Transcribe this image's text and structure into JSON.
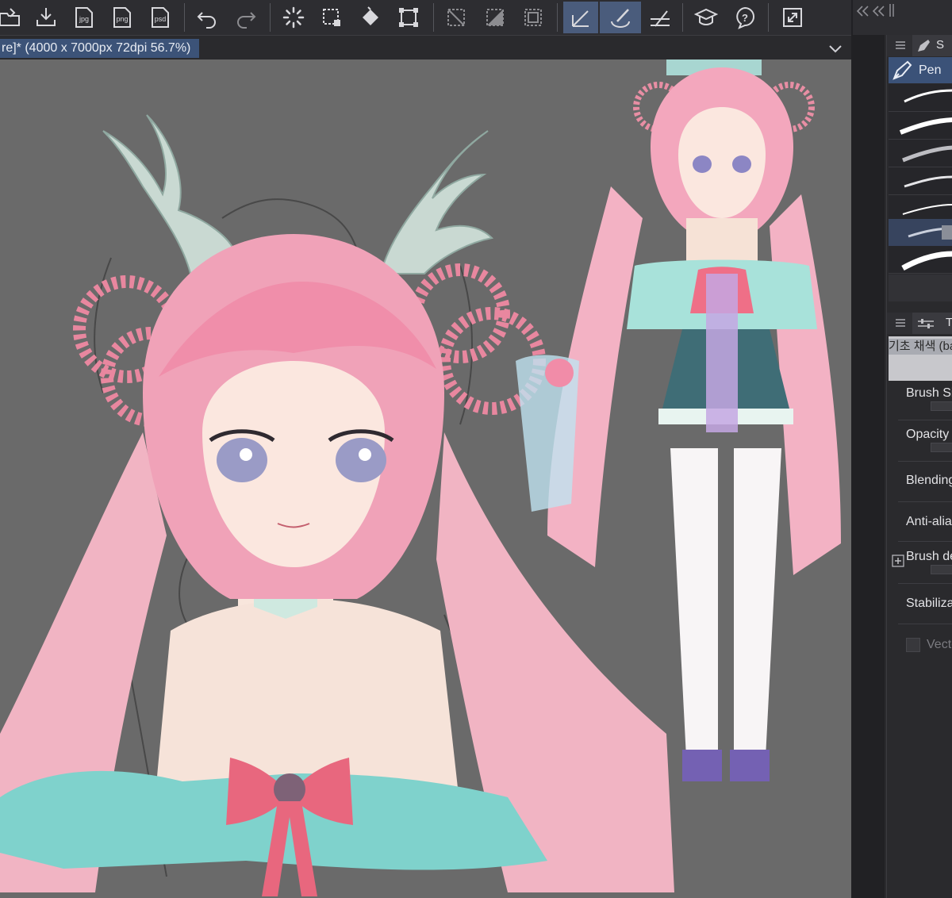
{
  "toolbar": {
    "buttons": [
      {
        "name": "open-file-icon"
      },
      {
        "name": "save-file-icon"
      },
      {
        "name": "export-jpg-icon",
        "label": "jpg"
      },
      {
        "name": "export-png-icon",
        "label": "png"
      },
      {
        "name": "export-psd-icon",
        "label": "psd"
      },
      {
        "name": "undo-icon"
      },
      {
        "name": "redo-icon"
      },
      {
        "name": "loading-spinner-icon"
      },
      {
        "name": "transform-selection-icon"
      },
      {
        "name": "fill-bucket-icon"
      },
      {
        "name": "transform-icon"
      },
      {
        "name": "deselect-icon"
      },
      {
        "name": "invert-selection-icon"
      },
      {
        "name": "select-all-icon"
      },
      {
        "name": "ruler-snap-icon"
      },
      {
        "name": "brush-snap-icon"
      },
      {
        "name": "line-snap-icon"
      },
      {
        "name": "tutorial-cap-icon"
      },
      {
        "name": "help-icon"
      },
      {
        "name": "fullscreen-icon"
      }
    ]
  },
  "document": {
    "tab_label": "re]* (4000 x 7000px 72dpi 56.7%)"
  },
  "colors": {
    "accent": "#3c5378",
    "canvas_bg": "#6a6a6a",
    "panel_bg": "#2a2a2d",
    "toolbar_bg": "#2d2d31"
  },
  "sub_tool_panel": {
    "tab_label": "S",
    "current_tool": "Pen",
    "strokes_count_visible": 7
  },
  "tool_property": {
    "tab_label": "T",
    "preset_name": "기초 채색 (ba",
    "properties": [
      {
        "label": "Brush Si",
        "has_slider": true
      },
      {
        "label": "Opacity",
        "has_slider": true
      },
      {
        "label": "Blending",
        "has_slider": false
      },
      {
        "label": "Anti-alia",
        "has_slider": false
      },
      {
        "label": "Brush de",
        "has_slider": true
      },
      {
        "label": "Stabiliza",
        "has_slider": false
      }
    ],
    "vector_label": "Vecto"
  }
}
